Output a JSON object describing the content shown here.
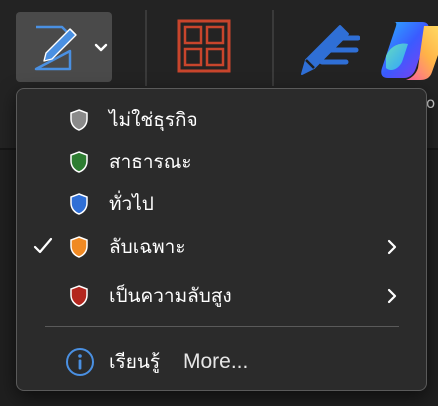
{
  "ribbon": {
    "sensitivity_button": {
      "icon": "sensitivity-icon",
      "dropdown_icon": "chevron-down-icon"
    },
    "grid_button": {
      "icon": "grid-layout-icon",
      "color": "#c8452c"
    },
    "editor_button": {
      "icon": "pen-icon",
      "color": "#2f6fd6"
    },
    "copilot_button": {
      "icon": "copilot-icon"
    },
    "stub_right": "o"
  },
  "menu": {
    "items": [
      {
        "label": "ไม่ใช่ธุรกิจ",
        "shield_color": "#8a8a8a",
        "checked": false,
        "has_submenu": false
      },
      {
        "label": "สาธารณะ",
        "shield_color": "#2e7d32",
        "checked": false,
        "has_submenu": false
      },
      {
        "label": "ทั่วไป",
        "shield_color": "#2f6fd6",
        "checked": false,
        "has_submenu": false
      },
      {
        "label": "ลับเฉพาะ",
        "shield_color": "#f08a24",
        "checked": true,
        "has_submenu": true
      },
      {
        "label": "เป็นความลับสูง",
        "shield_color": "#b3261e",
        "checked": false,
        "has_submenu": true
      }
    ],
    "learn": {
      "label": "เรียนรู้",
      "more": "More...",
      "icon": "info-icon"
    }
  }
}
